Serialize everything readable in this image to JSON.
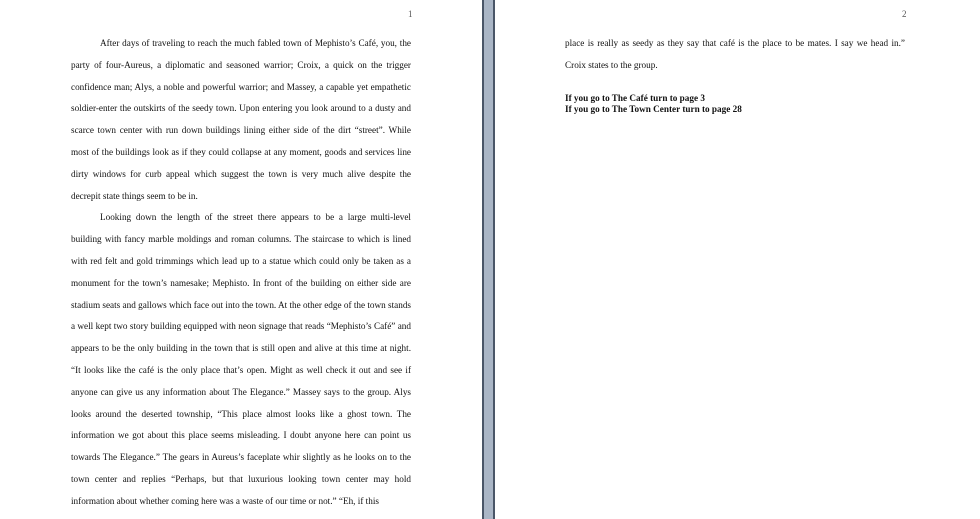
{
  "pages": [
    {
      "number": "1",
      "paragraphs": [
        "After days of traveling to reach the much fabled town of Mephisto’s Café, you, the party of four-Aureus, a diplomatic and seasoned warrior; Croix, a quick on the trigger confidence man; Alys, a noble and powerful warrior; and Massey, a capable yet empathetic soldier-enter the outskirts of the seedy town. Upon entering you look around to a dusty and scarce town center with run down buildings lining either side of the dirt “street”. While most of the buildings look as if they could collapse at any moment, goods and services line dirty windows for curb appeal which suggest the town is very much alive despite the decrepit state things seem to be in.",
        "Looking down the length of the street there appears to be a large multi-level building with fancy marble moldings and roman columns. The staircase to which is lined with red felt and gold trimmings which lead up to a statue which could only be taken as a monument for the town’s namesake; Mephisto. In front of the building on either side are stadium seats and gallows which face out into the town. At the other edge of the town stands a well kept two story building equipped with neon signage that reads “Mephisto’s Café” and appears to be the only building in the town that is still open and alive at this time at night. “It looks like the café is the only place that’s open. Might as well check it out and see if anyone can give us any information about The Elegance.” Massey says to the group. Alys looks around the deserted township, “This place almost looks like a ghost town. The information we got about this place seems misleading. I doubt anyone here can point us towards The Elegance.” The gears in Aureus’s faceplate whir slightly as he looks on to the town center and replies “Perhaps, but that luxurious looking town center may hold information about whether coming here was a waste of our time or not.” “Eh, if this"
      ]
    },
    {
      "number": "2",
      "paragraphs": [
        "place is really as seedy as they say that café is the place to be mates. I say we head in.” Croix states to the group."
      ],
      "choices": [
        "If you go to The Café turn to page 3",
        "If you go to The Town Center turn to page 28"
      ]
    }
  ]
}
